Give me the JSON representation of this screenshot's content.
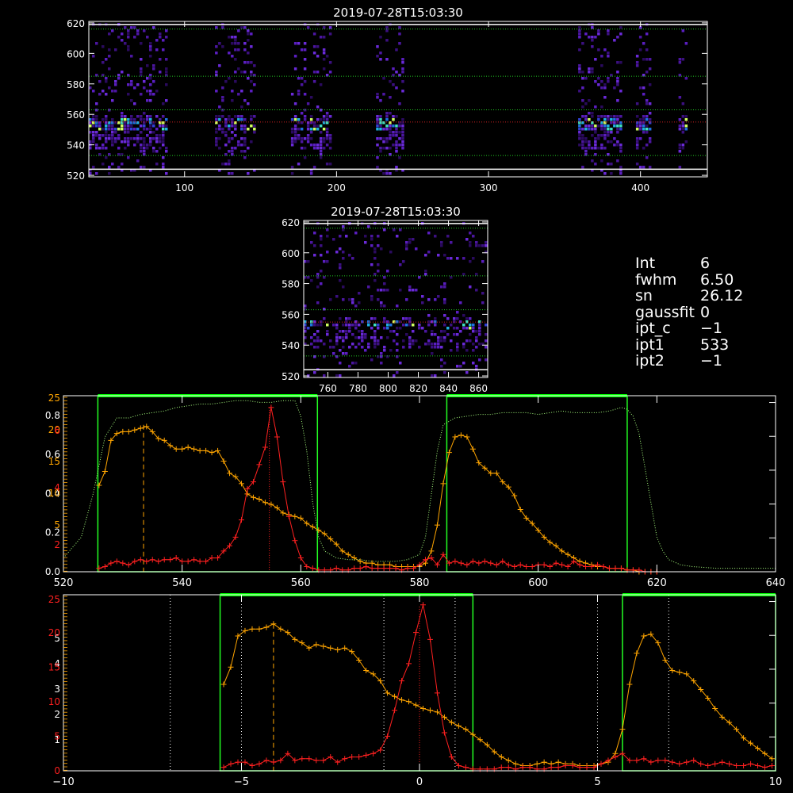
{
  "images": [
    {
      "title": "2019-07-28T15:03:30",
      "xticks": [
        "100",
        "200",
        "300",
        "400"
      ],
      "yticks": [
        "620",
        "600",
        "580",
        "560",
        "540",
        "520"
      ]
    },
    {
      "title": "2019-07-28T15:03:30",
      "xticks": [
        "760",
        "780",
        "800",
        "820",
        "840",
        "860"
      ],
      "yticks": [
        "620",
        "600",
        "580",
        "560",
        "540",
        "520"
      ]
    }
  ],
  "info": {
    "rows": [
      {
        "key": "Int",
        "value": "6"
      },
      {
        "key": "fwhm",
        "value": "6.50"
      },
      {
        "key": "sn",
        "value": "26.12"
      },
      {
        "key": "gaussfit",
        "value": "0"
      },
      {
        "key": "ipt_c",
        "value": "−1"
      },
      {
        "key": "ipt1",
        "value": "533"
      },
      {
        "key": "ipt2",
        "value": "−1"
      }
    ]
  },
  "colors": {
    "orange": "#ffa500",
    "red": "#ff2020",
    "green": "#00ff00",
    "pale_green": "#a8ff7f",
    "bright_green": "#22ff22",
    "yellow": "#ffff80",
    "white": "#ffffff"
  },
  "chart_data": [
    {
      "type": "line",
      "xlim": [
        520,
        640
      ],
      "xticks": [
        "520",
        "540",
        "560",
        "580",
        "600",
        "620",
        "640"
      ],
      "left_ticks_white": [
        "0.0",
        "0.2",
        "0.4",
        "0.6",
        "0.8"
      ],
      "left_ticks_orange": [
        "5",
        "10",
        "15",
        "20",
        "25"
      ],
      "left_ticks_red": [
        "2",
        "4",
        "6"
      ],
      "series": [
        {
          "color": "orange",
          "x": [
            526,
            527,
            528,
            529,
            530,
            531,
            532,
            533,
            534,
            535,
            536,
            537,
            538,
            539,
            540,
            541,
            542,
            543,
            544,
            545,
            546,
            547,
            548,
            549,
            550,
            551,
            552,
            553,
            554,
            555,
            556,
            557,
            558,
            559,
            560,
            561,
            562,
            563,
            564,
            565,
            566,
            567,
            568,
            569,
            570,
            571,
            572,
            573,
            574,
            575,
            576,
            577,
            578,
            579,
            580,
            581,
            582,
            583,
            584,
            585,
            586,
            587,
            588,
            589,
            590,
            591,
            592,
            593,
            594,
            595,
            596,
            597,
            598,
            599,
            600,
            601,
            602,
            603,
            604,
            605,
            606,
            607,
            608,
            609,
            610,
            611,
            612,
            613,
            614,
            615,
            616,
            617,
            618,
            619,
            620
          ],
          "y": [
            0.5,
            0.58,
            0.76,
            0.8,
            0.81,
            0.81,
            0.82,
            0.83,
            0.84,
            0.81,
            0.77,
            0.76,
            0.73,
            0.71,
            0.71,
            0.72,
            0.71,
            0.7,
            0.7,
            0.69,
            0.7,
            0.64,
            0.57,
            0.55,
            0.51,
            0.45,
            0.43,
            0.42,
            0.4,
            0.39,
            0.37,
            0.34,
            0.33,
            0.32,
            0.31,
            0.28,
            0.26,
            0.24,
            0.22,
            0.19,
            0.16,
            0.12,
            0.1,
            0.08,
            0.06,
            0.05,
            0.05,
            0.04,
            0.04,
            0.04,
            0.03,
            0.03,
            0.03,
            0.03,
            0.03,
            0.05,
            0.12,
            0.27,
            0.51,
            0.69,
            0.78,
            0.79,
            0.78,
            0.71,
            0.63,
            0.6,
            0.57,
            0.57,
            0.52,
            0.49,
            0.44,
            0.36,
            0.31,
            0.28,
            0.24,
            0.2,
            0.17,
            0.15,
            0.12,
            0.1,
            0.08,
            0.06,
            0.05,
            0.04,
            0.03,
            0.03,
            0.02,
            0.02,
            0.02,
            0.01,
            0.01,
            0.0,
            0.0,
            0.0,
            0.0
          ]
        },
        {
          "color": "red",
          "x": [
            526,
            527,
            528,
            529,
            530,
            531,
            532,
            533,
            534,
            535,
            536,
            537,
            538,
            539,
            540,
            541,
            542,
            543,
            544,
            545,
            546,
            547,
            548,
            549,
            550,
            551,
            552,
            553,
            554,
            555,
            556,
            557,
            558,
            559,
            560,
            561,
            562,
            563,
            564,
            565,
            566,
            567,
            568,
            569,
            570,
            571,
            572,
            573,
            574,
            575,
            576,
            577,
            578,
            579,
            580,
            581,
            582,
            583,
            584,
            585,
            586,
            587,
            588,
            589,
            590,
            591,
            592,
            593,
            594,
            595,
            596,
            597,
            598,
            599,
            600,
            601,
            602,
            603,
            604,
            605,
            606,
            607,
            608,
            609,
            610,
            611,
            612,
            613,
            614,
            615,
            616,
            617,
            618,
            619,
            620
          ],
          "y": [
            0.02,
            0.03,
            0.05,
            0.06,
            0.05,
            0.04,
            0.06,
            0.07,
            0.06,
            0.07,
            0.06,
            0.07,
            0.07,
            0.08,
            0.06,
            0.06,
            0.07,
            0.06,
            0.06,
            0.08,
            0.08,
            0.12,
            0.15,
            0.2,
            0.3,
            0.48,
            0.52,
            0.62,
            0.72,
            0.95,
            0.78,
            0.52,
            0.32,
            0.18,
            0.08,
            0.03,
            0.02,
            0.01,
            0.01,
            0.01,
            0.02,
            0.01,
            0.01,
            0.02,
            0.02,
            0.03,
            0.02,
            0.02,
            0.02,
            0.02,
            0.02,
            0.01,
            0.02,
            0.02,
            0.04,
            0.07,
            0.08,
            0.04,
            0.1,
            0.05,
            0.06,
            0.05,
            0.04,
            0.06,
            0.05,
            0.06,
            0.05,
            0.04,
            0.06,
            0.04,
            0.03,
            0.04,
            0.03,
            0.03,
            0.04,
            0.04,
            0.03,
            0.05,
            0.04,
            0.03,
            0.06,
            0.04,
            0.03,
            0.03,
            0.04,
            0.03,
            0.02,
            0.02,
            0.02,
            0.01,
            0.01,
            0.01,
            0.0,
            0.0,
            0.0
          ]
        },
        {
          "color": "pale_green",
          "dashed": true,
          "x": [
            520,
            523,
            525,
            527,
            529,
            531,
            533,
            535,
            537,
            539,
            541,
            543,
            545,
            547,
            549,
            551,
            553,
            555,
            557,
            559,
            560,
            561,
            562,
            563,
            564,
            566,
            568,
            570,
            572,
            574,
            576,
            578,
            580,
            581,
            582,
            583,
            584,
            586,
            588,
            590,
            592,
            594,
            596,
            598,
            600,
            602,
            604,
            606,
            608,
            610,
            612,
            614,
            615,
            616,
            617,
            618,
            619,
            620,
            621,
            622,
            624,
            626,
            630,
            634,
            638,
            640
          ],
          "y": [
            0.08,
            0.2,
            0.45,
            0.78,
            0.89,
            0.89,
            0.91,
            0.92,
            0.93,
            0.95,
            0.96,
            0.97,
            0.97,
            0.98,
            0.99,
            0.99,
            0.98,
            0.98,
            0.99,
            0.99,
            0.9,
            0.7,
            0.4,
            0.2,
            0.12,
            0.08,
            0.07,
            0.07,
            0.06,
            0.06,
            0.06,
            0.07,
            0.1,
            0.2,
            0.45,
            0.7,
            0.85,
            0.89,
            0.9,
            0.91,
            0.91,
            0.92,
            0.92,
            0.92,
            0.91,
            0.92,
            0.93,
            0.92,
            0.92,
            0.92,
            0.93,
            0.95,
            0.94,
            0.9,
            0.8,
            0.6,
            0.4,
            0.2,
            0.12,
            0.07,
            0.04,
            0.03,
            0.02,
            0.02,
            0.02,
            0.02
          ]
        }
      ],
      "windows": [
        [
          525.8,
          562.8
        ],
        [
          584.6,
          615.0
        ]
      ],
      "orange_peak_x": 533.5,
      "red_peak_x": 554.7
    },
    {
      "type": "line",
      "xlim": [
        -10,
        10
      ],
      "xticks": [
        "−10",
        "−5",
        "0",
        "5",
        "10"
      ],
      "left_ticks_white": [
        "1",
        "2",
        "3",
        "4",
        "5"
      ],
      "left_ticks_red": [
        "0",
        "5",
        "10",
        "15",
        "20",
        "25"
      ],
      "series": [
        {
          "color": "orange",
          "x": [
            -5.5,
            -5.3,
            -5.1,
            -4.9,
            -4.7,
            -4.5,
            -4.3,
            -4.1,
            -3.9,
            -3.7,
            -3.5,
            -3.3,
            -3.1,
            -2.9,
            -2.7,
            -2.5,
            -2.3,
            -2.1,
            -1.9,
            -1.7,
            -1.5,
            -1.3,
            -1.1,
            -0.9,
            -0.7,
            -0.5,
            -0.3,
            -0.1,
            0.1,
            0.3,
            0.5,
            0.7,
            0.9,
            1.1,
            1.3,
            1.5,
            1.7,
            1.9,
            2.1,
            2.3,
            2.5,
            2.7,
            2.9,
            3.1,
            3.3,
            3.5,
            3.7,
            3.9,
            4.1,
            4.3,
            4.5,
            4.7,
            4.9,
            5.1,
            5.3,
            5.5,
            5.7,
            5.9,
            6.1,
            6.3,
            6.5,
            6.7,
            6.9,
            7.1,
            7.3,
            7.5,
            7.7,
            7.9,
            8.1,
            8.3,
            8.5,
            8.7,
            8.9,
            9.1,
            9.3,
            9.5,
            9.7,
            9.9
          ],
          "y": [
            0.5,
            0.6,
            0.78,
            0.81,
            0.82,
            0.82,
            0.83,
            0.85,
            0.82,
            0.8,
            0.76,
            0.74,
            0.71,
            0.73,
            0.72,
            0.71,
            0.7,
            0.71,
            0.69,
            0.64,
            0.58,
            0.56,
            0.52,
            0.45,
            0.43,
            0.41,
            0.4,
            0.38,
            0.36,
            0.35,
            0.34,
            0.31,
            0.28,
            0.26,
            0.24,
            0.21,
            0.18,
            0.15,
            0.11,
            0.08,
            0.06,
            0.04,
            0.03,
            0.03,
            0.04,
            0.05,
            0.04,
            0.05,
            0.04,
            0.04,
            0.03,
            0.03,
            0.03,
            0.04,
            0.05,
            0.1,
            0.24,
            0.5,
            0.68,
            0.78,
            0.79,
            0.74,
            0.64,
            0.58,
            0.57,
            0.56,
            0.52,
            0.47,
            0.42,
            0.36,
            0.31,
            0.28,
            0.24,
            0.19,
            0.16,
            0.13,
            0.1,
            0.07
          ]
        },
        {
          "color": "red",
          "x": [
            -5.5,
            -5.3,
            -5.1,
            -4.9,
            -4.7,
            -4.5,
            -4.3,
            -4.1,
            -3.9,
            -3.7,
            -3.5,
            -3.3,
            -3.1,
            -2.9,
            -2.7,
            -2.5,
            -2.3,
            -2.1,
            -1.9,
            -1.7,
            -1.5,
            -1.3,
            -1.1,
            -0.9,
            -0.7,
            -0.5,
            -0.3,
            -0.1,
            0.1,
            0.3,
            0.5,
            0.7,
            0.9,
            1.1,
            1.3,
            1.5,
            1.7,
            1.9,
            2.1,
            2.3,
            2.5,
            2.7,
            2.9,
            3.1,
            3.3,
            3.5,
            3.7,
            3.9,
            4.1,
            4.3,
            4.5,
            4.7,
            4.9,
            5.1,
            5.3,
            5.5,
            5.7,
            5.9,
            6.1,
            6.3,
            6.5,
            6.7,
            6.9,
            7.1,
            7.3,
            7.5,
            7.7,
            7.9,
            8.1,
            8.3,
            8.5,
            8.7,
            8.9,
            9.1,
            9.3,
            9.5,
            9.7,
            9.9
          ],
          "y": [
            0.02,
            0.04,
            0.05,
            0.05,
            0.03,
            0.04,
            0.06,
            0.05,
            0.06,
            0.1,
            0.06,
            0.07,
            0.07,
            0.06,
            0.06,
            0.08,
            0.05,
            0.07,
            0.08,
            0.08,
            0.09,
            0.1,
            0.12,
            0.2,
            0.35,
            0.52,
            0.62,
            0.8,
            0.96,
            0.76,
            0.45,
            0.22,
            0.08,
            0.03,
            0.02,
            0.01,
            0.01,
            0.01,
            0.01,
            0.02,
            0.02,
            0.01,
            0.02,
            0.02,
            0.01,
            0.01,
            0.02,
            0.02,
            0.03,
            0.03,
            0.02,
            0.02,
            0.02,
            0.04,
            0.06,
            0.08,
            0.1,
            0.06,
            0.06,
            0.07,
            0.05,
            0.06,
            0.06,
            0.05,
            0.04,
            0.05,
            0.06,
            0.04,
            0.03,
            0.04,
            0.05,
            0.04,
            0.03,
            0.03,
            0.04,
            0.03,
            0.02,
            0.03
          ]
        }
      ],
      "windows": [
        [
          -5.6,
          1.5
        ],
        [
          5.7,
          10
        ]
      ],
      "white_vlines": [
        -7,
        -5,
        -1,
        1,
        5,
        7
      ],
      "orange_peak_x": -4.1,
      "red_peak_x": 0.0
    }
  ]
}
